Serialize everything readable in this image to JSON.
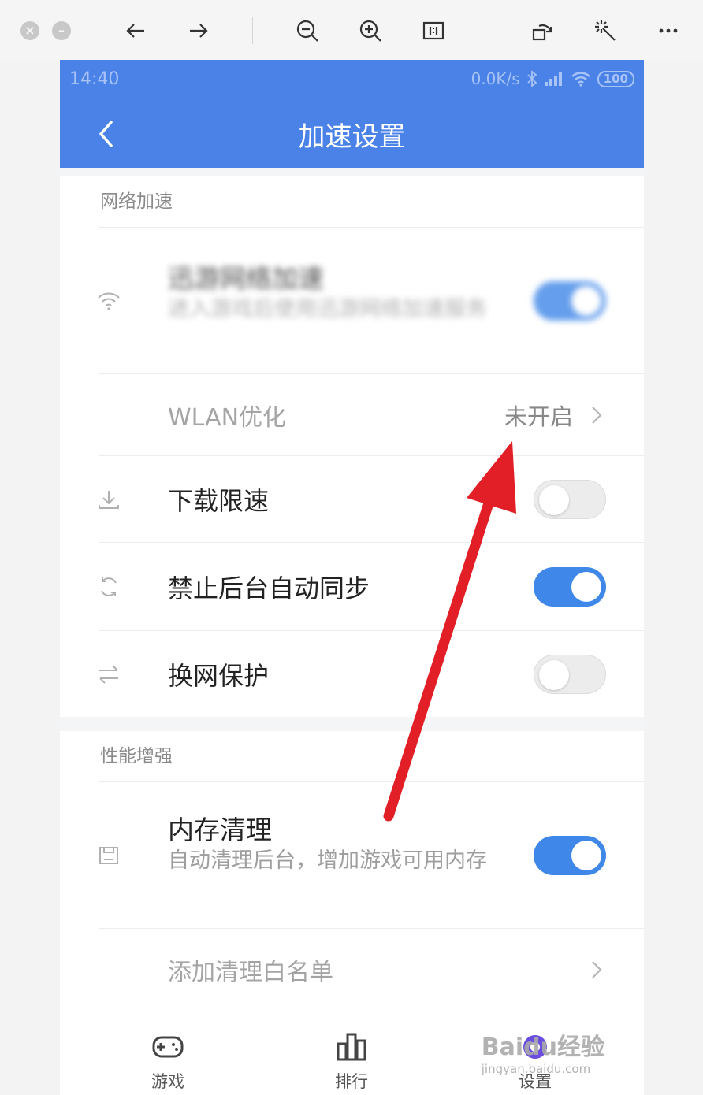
{
  "viewer": {
    "close_icon": "close-icon",
    "minimize_icon": "minimize-icon",
    "icons": [
      "back-arrow-icon",
      "forward-arrow-icon",
      "zoom-out-icon",
      "zoom-in-icon",
      "actual-size-icon",
      "rotate-icon",
      "magic-wand-icon",
      "more-icon"
    ]
  },
  "status_bar": {
    "time": "14:40",
    "speed": "0.0K/s",
    "battery": "100"
  },
  "header": {
    "title": "加速设置"
  },
  "section_network": {
    "title": "网络加速",
    "items": [
      {
        "label": "迅游网络加速",
        "subtitle": "进入游戏后使用迅游网络加速服务",
        "toggle": true,
        "blurred": true
      },
      {
        "label": "WLAN优化",
        "value": "未开启",
        "has_chevron": true
      },
      {
        "label": "下载限速",
        "toggle": false
      },
      {
        "label": "禁止后台自动同步",
        "toggle": true
      },
      {
        "label": "换网保护",
        "toggle": false
      }
    ]
  },
  "section_performance": {
    "title": "性能增强",
    "items": [
      {
        "label": "内存清理",
        "subtitle": "自动清理后台，增加游戏可用内存",
        "toggle": true
      },
      {
        "label": "添加清理白名单",
        "has_chevron": true
      }
    ]
  },
  "tabbar": {
    "items": [
      {
        "label": "游戏",
        "icon": "gamepad-icon"
      },
      {
        "label": "排行",
        "icon": "ranking-icon"
      },
      {
        "label": "设置",
        "icon": "settings-icon",
        "active": true
      }
    ]
  },
  "watermark": {
    "brand": "Baidu经验",
    "url": "jingyan.baidu.com"
  },
  "colors": {
    "accent": "#4a82e8",
    "toggle_on": "#3f87e8",
    "annotation_arrow": "#e21f26"
  }
}
